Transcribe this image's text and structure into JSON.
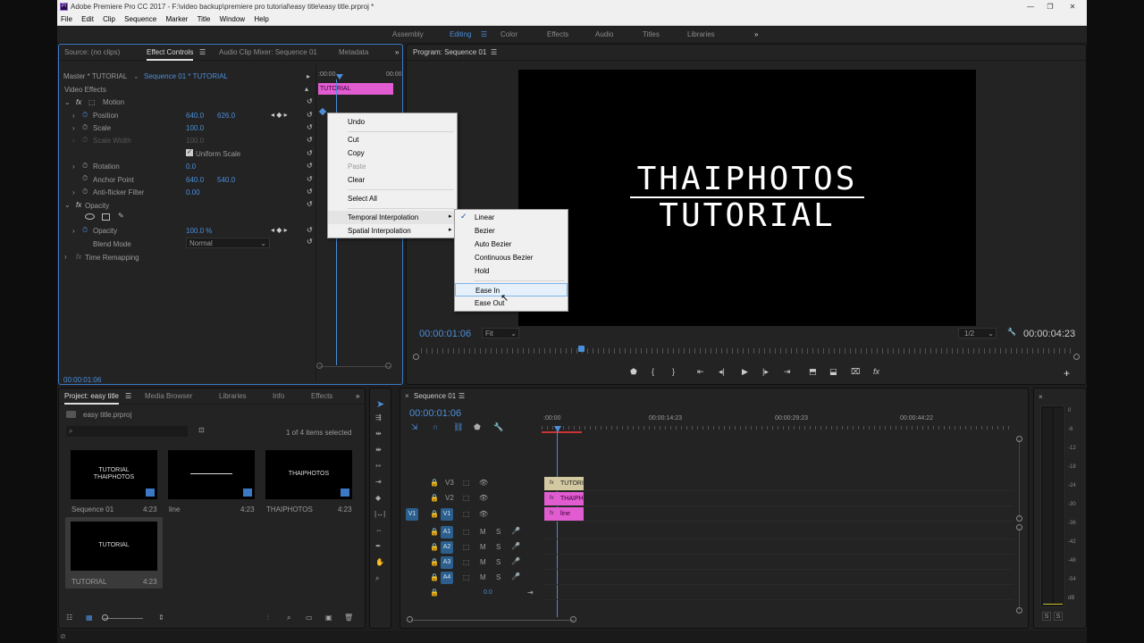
{
  "window": {
    "title": "Adobe Premiere Pro CC 2017 - F:\\video backup\\premiere pro tutorial\\easy title\\easy title.prproj *"
  },
  "menu": [
    "File",
    "Edit",
    "Clip",
    "Sequence",
    "Marker",
    "Title",
    "Window",
    "Help"
  ],
  "workspaces": [
    "Assembly",
    "Editing",
    "Color",
    "Effects",
    "Audio",
    "Titles",
    "Libraries"
  ],
  "source_tabs": {
    "source": "Source: (no clips)",
    "effect_controls": "Effect Controls",
    "audio_mixer": "Audio Clip Mixer: Sequence 01",
    "metadata": "Metadata"
  },
  "effect_controls": {
    "master": "Master * TUTORIAL",
    "sequence": "Sequence 01 * TUTORIAL",
    "video_effects": "Video Effects",
    "ruler_start": ":00:00",
    "ruler_end": "00:00",
    "clip_label": "TUTORIAL",
    "motion": "Motion",
    "position_label": "Position",
    "position_x": "640.0",
    "position_y": "626.0",
    "scale_label": "Scale",
    "scale_val": "100.0",
    "scale_width_label": "Scale Width",
    "scale_width_val": "100.0",
    "uniform_scale": "Uniform Scale",
    "rotation_label": "Rotation",
    "rotation_val": "0.0",
    "anchor_label": "Anchor Point",
    "anchor_x": "640.0",
    "anchor_y": "540.0",
    "antiflicker_label": "Anti-flicker Filter",
    "antiflicker_val": "0.00",
    "opacity_group": "Opacity",
    "opacity_label": "Opacity",
    "opacity_val": "100.0 %",
    "blend_label": "Blend Mode",
    "blend_val": "Normal",
    "time_remap": "Time Remapping",
    "timecode": "00:00:01:06"
  },
  "context_menu": {
    "undo": "Undo",
    "cut": "Cut",
    "copy": "Copy",
    "paste": "Paste",
    "clear": "Clear",
    "select_all": "Select All",
    "temporal": "Temporal Interpolation",
    "spatial": "Spatial Interpolation"
  },
  "submenu": {
    "linear": "Linear",
    "bezier": "Bezier",
    "auto_bezier": "Auto Bezier",
    "continuous_bezier": "Continuous Bezier",
    "hold": "Hold",
    "ease_in": "Ease In",
    "ease_out": "Ease Out"
  },
  "program": {
    "tab": "Program: Sequence 01",
    "title_line1": "THAIPHOTOS",
    "title_line2": "TUTORIAL",
    "timecode": "00:00:01:06",
    "fit": "Fit",
    "resolution": "1/2",
    "duration": "00:00:04:23"
  },
  "project": {
    "tabs": [
      "Project: easy title",
      "Media Browser",
      "Libraries",
      "Info",
      "Effects"
    ],
    "file": "easy title.prproj",
    "selected_count": "1 of 4 items selected",
    "items": [
      {
        "name": "Sequence 01",
        "dur": "4:23",
        "thumb": "TUTORIAL\nTHAIPHOTOS"
      },
      {
        "name": "line",
        "dur": "4:23",
        "thumb": ""
      },
      {
        "name": "THAIPHOTOS",
        "dur": "4:23",
        "thumb": "THAIPHOTOS"
      },
      {
        "name": "TUTORIAL",
        "dur": "4:23",
        "thumb": "TUTORIAL"
      }
    ]
  },
  "timeline": {
    "tab": "Sequence 01",
    "timecode": "00:00:01:06",
    "ruler": [
      ":00:00",
      "00:00:14:23",
      "00:00:29:23",
      "00:00:44:22"
    ],
    "video_tracks": [
      "V3",
      "V2",
      "V1"
    ],
    "source_patch": "V1",
    "audio_tracks": [
      "A1",
      "A2",
      "A3",
      "A4"
    ],
    "master_vol": "0.0",
    "clips": [
      "TUTORI",
      "THAIPH",
      "line"
    ]
  },
  "meter_scale": [
    "0",
    "-6",
    "-12",
    "-18",
    "-24",
    "-30",
    "-36",
    "-42",
    "-48",
    "-54",
    "dB"
  ],
  "meter_solo": [
    "S",
    "S"
  ]
}
